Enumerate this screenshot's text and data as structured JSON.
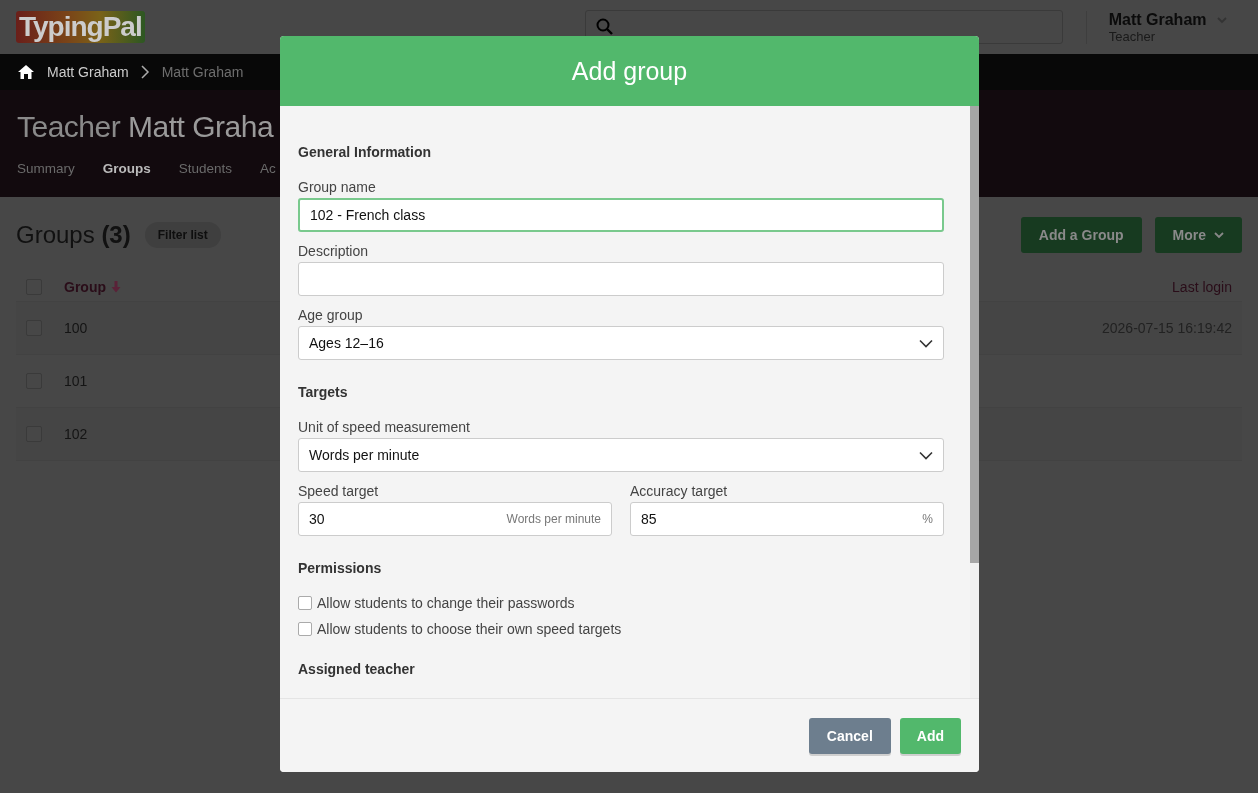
{
  "header": {
    "logo": "TypingPal",
    "user_name": "Matt Graham",
    "user_role": "Teacher"
  },
  "breadcrumb": [
    {
      "label": "Matt Graham",
      "current": false
    },
    {
      "label": "Matt Graham",
      "current": true
    }
  ],
  "hero": {
    "title_prefix": "Teacher",
    "title_name": "Matt Graha",
    "tabs": [
      {
        "label": "Summary",
        "selected": false
      },
      {
        "label": "Groups",
        "selected": true
      },
      {
        "label": "Students",
        "selected": false
      },
      {
        "label": "Ac",
        "selected": false
      }
    ]
  },
  "groups": {
    "title": "Groups **(3)**",
    "filter": "Filter list",
    "buttons": [
      {
        "label": "Add a Group",
        "kind": "plain"
      },
      {
        "label": "More",
        "kind": "menu"
      }
    ]
  },
  "table": {
    "columns": [
      "Group",
      "Last login"
    ],
    "all_checked": false,
    "rows": [
      {
        "group": "100",
        "last_login": "2026-07-15 16:19:42",
        "checked": false
      },
      {
        "group": "101",
        "checked": false
      },
      {
        "group": "102",
        "checked": false
      }
    ]
  },
  "dialog": {
    "title": "Add group",
    "sections": [
      {
        "heading": "General Information",
        "items": [
          {
            "kind": "text",
            "label": "Group name",
            "value": "102 - French class",
            "focused": true
          },
          {
            "kind": "text",
            "label": "Description",
            "focused": false
          },
          {
            "kind": "select",
            "label": "Age group",
            "value": "Ages 12–16"
          }
        ]
      },
      {
        "heading": "Targets",
        "items": [
          {
            "kind": "select",
            "label": "Unit of speed measurement",
            "value": "Words per minute"
          },
          {
            "kind": "pair",
            "fields": [
              {
                "label": "Speed target",
                "value": "30",
                "unit": "Words per minute"
              },
              {
                "label": "Accuracy target",
                "value": "85",
                "unit": "%"
              }
            ]
          }
        ]
      },
      {
        "heading": "Permissions",
        "items": [
          {
            "kind": "checkbox",
            "label": "Allow students to change their passwords",
            "checked": false
          },
          {
            "kind": "checkbox",
            "label": "Allow students to choose their own speed targets",
            "checked": false
          }
        ]
      },
      {
        "heading": "Assigned teacher"
      }
    ],
    "buttons": [
      {
        "label": "Cancel",
        "kind": "secondary"
      },
      {
        "label": "Add",
        "kind": "primary"
      }
    ]
  }
}
